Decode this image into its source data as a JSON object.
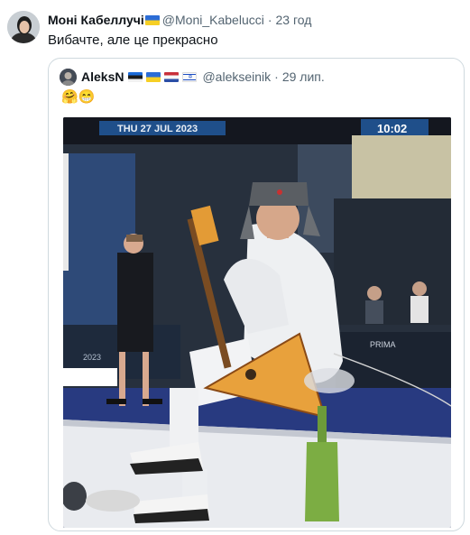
{
  "tweet": {
    "author_name": "Моні Кабеллучі",
    "author_flag": "ukraine-flag-icon",
    "handle": "@Moni_Kabelucci",
    "separator": "·",
    "time": "23 год",
    "text": "Вибачте, але це прекрасно"
  },
  "quoted": {
    "author_name": "AleksN",
    "flags": [
      "estonia-flag-icon",
      "ukraine-flag-icon",
      "netherlands-flag-icon",
      "israel-flag-icon"
    ],
    "handle": "@alekseinik",
    "separator": "·",
    "time": "29 лип.",
    "emoji": "🤗😁",
    "image": {
      "scoreboard_date": "THU 27 JUL 2023",
      "scoreboard_time": "10:02",
      "banner_text": "PRIMA",
      "board_text": "2023"
    }
  }
}
